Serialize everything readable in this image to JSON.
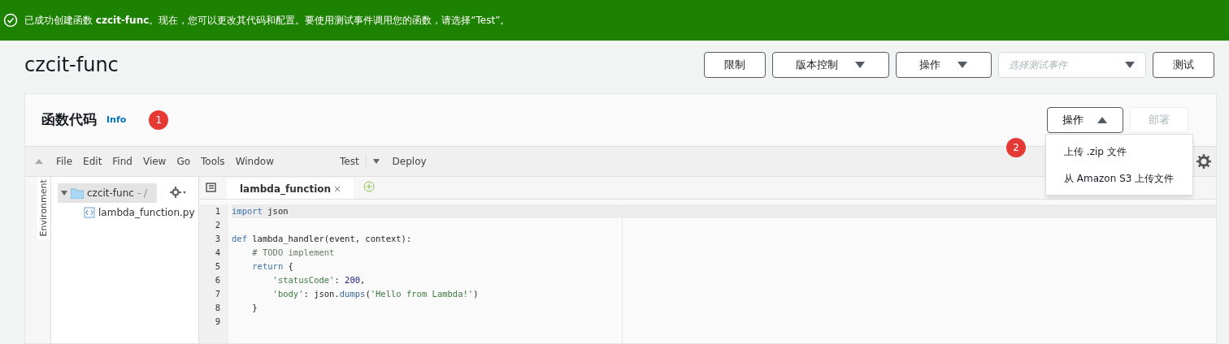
{
  "banner": {
    "message": "已成功创建函数 **czcit-func**。现在，您可以更改其代码和配置。要使用测试事件调用您的函数，请选择“Test”。"
  },
  "page_title": "czcit-func",
  "header_buttons": [
    {
      "kind": "button",
      "label": "限制"
    },
    {
      "kind": "dropdown",
      "label": "版本控制"
    },
    {
      "kind": "dropdown",
      "label": "操作"
    },
    {
      "kind": "select",
      "placeholder": "选择测试事件"
    },
    {
      "kind": "button",
      "label": "测试"
    }
  ],
  "panel": {
    "title": "函数代码",
    "info_link": "Info",
    "actions_button": {
      "label": "操作",
      "expanded": true
    },
    "deploy_button": {
      "label": "部署",
      "disabled": true
    },
    "menu": [
      "上传 .zip 文件",
      "从 Amazon S3 上传文件"
    ]
  },
  "annotations": [
    "1",
    "2"
  ],
  "ide": {
    "menus": [
      "File",
      "Edit",
      "Find",
      "View",
      "Go",
      "Tools",
      "Window"
    ],
    "run_button": "Test",
    "deploy": "Deploy",
    "side_tab": "Environment",
    "tree": [
      {
        "name": "czcit-func",
        "suffix": "- /",
        "expanded": true,
        "children": [
          {
            "name": "lambda_function.py"
          }
        ]
      }
    ],
    "tabs": [
      {
        "label": "lambda_function",
        "selected": true
      }
    ],
    "lines": [
      {
        "number": "1",
        "tokens": [
          {
            "kind": "keyword",
            "text": "import"
          },
          {
            "kind": "plain",
            "text": " json"
          }
        ]
      },
      {
        "number": "2"
      },
      {
        "number": "3",
        "tokens": [
          {
            "kind": "keyword",
            "text": "def"
          },
          {
            "kind": "plain",
            "text": " lambda_handler(event, context):"
          }
        ]
      },
      {
        "number": "4",
        "tokens": [
          {
            "kind": "comment",
            "text": "    # TODO implement"
          }
        ]
      },
      {
        "number": "5",
        "tokens": [
          {
            "kind": "keyword",
            "text": "    return"
          },
          {
            "kind": "plain",
            "text": " {"
          }
        ]
      },
      {
        "number": "6",
        "tokens": [
          {
            "kind": "string",
            "text": "        'statusCode'"
          },
          {
            "kind": "plain",
            "text": ": "
          },
          {
            "kind": "number",
            "text": "200"
          },
          {
            "kind": "plain",
            "text": ","
          }
        ]
      },
      {
        "number": "7",
        "tokens": [
          {
            "kind": "string",
            "text": "        'body'"
          },
          {
            "kind": "plain",
            "text": ": json."
          },
          {
            "kind": "call",
            "text": "dumps"
          },
          {
            "kind": "plain",
            "text": "("
          },
          {
            "kind": "string",
            "text": "'Hello from Lambda!'"
          },
          {
            "kind": "plain",
            "text": ")"
          }
        ]
      },
      {
        "number": "8",
        "tokens": [
          {
            "kind": "plain",
            "text": "    }"
          }
        ]
      },
      {
        "number": "9"
      }
    ]
  }
}
